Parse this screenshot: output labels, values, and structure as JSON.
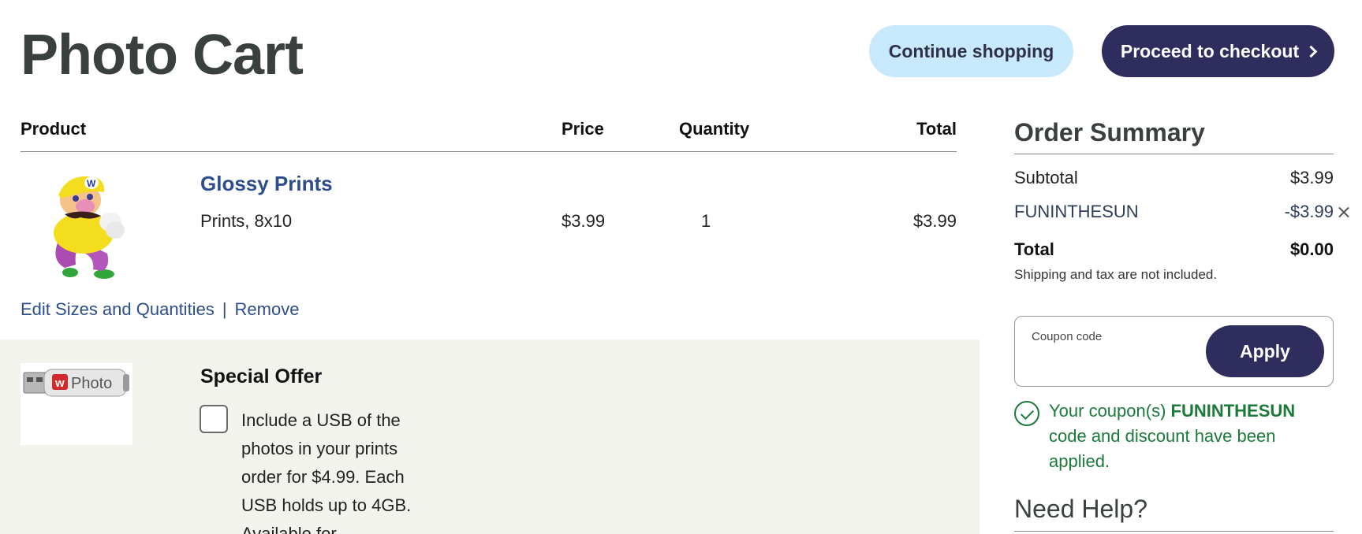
{
  "page": {
    "title": "Photo Cart"
  },
  "actions": {
    "continue_label": "Continue shopping",
    "checkout_label": "Proceed to checkout"
  },
  "table": {
    "headers": {
      "product": "Product",
      "price": "Price",
      "quantity": "Quantity",
      "total": "Total"
    }
  },
  "cart_item": {
    "name": "Glossy Prints",
    "description": "Prints, 8x10",
    "price": "$3.99",
    "quantity": "1",
    "total": "$3.99",
    "image_icon": "wario-character-image"
  },
  "item_links": {
    "edit_label": "Edit Sizes and Quantities",
    "separator": "|",
    "remove_label": "Remove"
  },
  "special_offer": {
    "title": "Special Offer",
    "text": "Include a USB of the photos in your prints order for $4.99. Each USB holds up to 4GB. Available for",
    "checked": false,
    "usb_brand_text": "Photo",
    "image_icon": "usb-drive-image"
  },
  "order_summary": {
    "title": "Order Summary",
    "subtotal_label": "Subtotal",
    "subtotal_value": "$3.99",
    "coupon_code": "FUNINTHESUN",
    "coupon_value": "-$3.99",
    "total_label": "Total",
    "total_value": "$0.00",
    "note": "Shipping and tax are not included."
  },
  "coupon_form": {
    "label": "Coupon code",
    "value": "",
    "apply_label": "Apply"
  },
  "coupon_message": {
    "prefix": "Your coupon(s) ",
    "code": "FUNINTHESUN",
    "suffix": " code and discount have been applied."
  },
  "help": {
    "title": "Need Help?"
  },
  "colors": {
    "primary_dark": "#2f2c5e",
    "light_blue": "#c8e8fb",
    "link_blue": "#2d4e8e",
    "success_green": "#1b7a3a",
    "offer_bg": "#f3f3ee",
    "title_gray": "#3a3f40"
  }
}
